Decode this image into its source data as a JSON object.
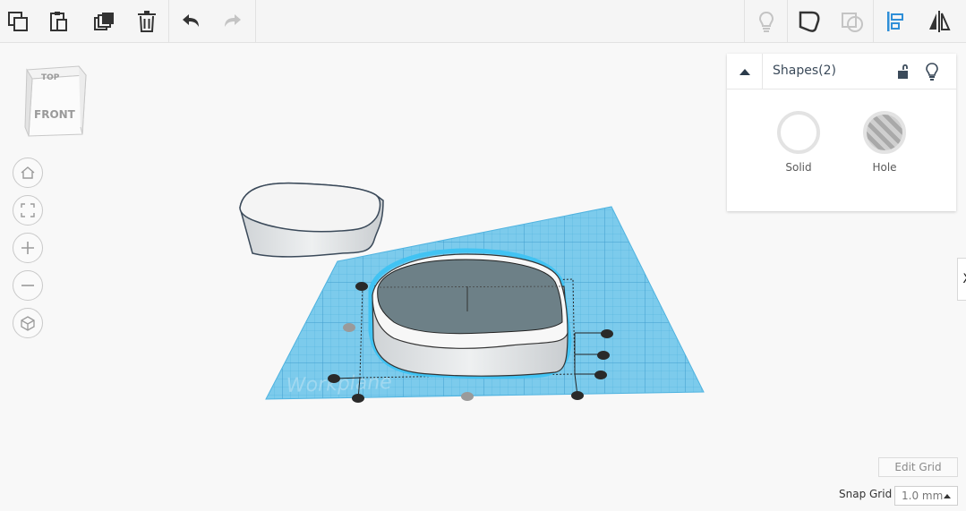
{
  "toolbar": {
    "items": [
      {
        "name": "copy",
        "icon": "copy-icon"
      },
      {
        "name": "paste",
        "icon": "paste-icon"
      },
      {
        "name": "duplicate",
        "icon": "duplicate-icon"
      },
      {
        "name": "delete",
        "icon": "trash-icon"
      },
      {
        "name": "undo",
        "icon": "undo-icon"
      },
      {
        "name": "redo",
        "icon": "redo-icon"
      },
      {
        "name": "note",
        "icon": "lightbulb-icon"
      },
      {
        "name": "group",
        "icon": "group-icon"
      },
      {
        "name": "ungroup",
        "icon": "ungroup-icon"
      },
      {
        "name": "align",
        "icon": "align-icon"
      },
      {
        "name": "mirror",
        "icon": "mirror-icon"
      }
    ],
    "colors": {
      "icon": "#333333",
      "disabled": "#c4c4c4",
      "accent": "#2f8fd8"
    }
  },
  "viewcube": {
    "top_label": "TOP",
    "front_label": "FRONT"
  },
  "nav": [
    {
      "name": "home",
      "icon": "home-icon"
    },
    {
      "name": "fit",
      "icon": "fit-view-icon"
    },
    {
      "name": "zoom-in",
      "icon": "plus-icon"
    },
    {
      "name": "zoom-out",
      "icon": "minus-icon"
    },
    {
      "name": "ortho",
      "icon": "perspective-icon"
    }
  ],
  "workplane": {
    "label": "Workplane",
    "color": "#5bc0eb"
  },
  "shapes_panel": {
    "title": "Shapes(2)",
    "solid_label": "Solid",
    "hole_label": "Hole"
  },
  "side_tab": {
    "label": "X"
  },
  "grid": {
    "edit_label": "Edit Grid",
    "snap_label": "Snap Grid",
    "snap_value": "1.0 mm"
  }
}
